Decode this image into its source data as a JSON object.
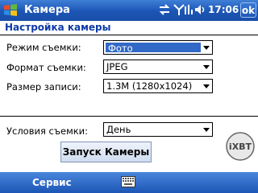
{
  "titlebar": {
    "title": "Камера",
    "clock": "17:06",
    "ok_label": "ok",
    "status_icons": [
      "sync-icon",
      "signal-icon",
      "close-signal-icon",
      "speaker-icon"
    ]
  },
  "page": {
    "header": "Настройка камеры"
  },
  "form": {
    "mode_label": "Режим съемки:",
    "mode_value": "Фото",
    "format_label": "Формат съемки:",
    "format_value": "JPEG",
    "size_label": "Размер записи:",
    "size_value": "1.3M (1280x1024)",
    "conditions_label": "Условия съемки:",
    "conditions_value": "День"
  },
  "start_button": "Запуск Камеры",
  "menubar": {
    "left_menu": "Сервис"
  },
  "watermark": "iXBT",
  "colors": {
    "bar": "#1c55b5",
    "header_text": "#0e3aa8",
    "selection": "#3169c6"
  }
}
